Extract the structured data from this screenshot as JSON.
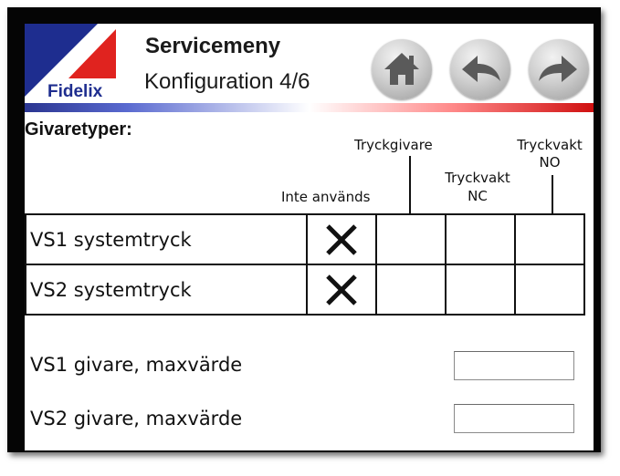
{
  "header": {
    "brand": "Fidelix",
    "title": "Servicemeny",
    "subtitle": "Konfiguration 4/6"
  },
  "nav": {
    "home_icon": "home-icon",
    "back_icon": "back-arrow-icon",
    "forward_icon": "forward-arrow-icon"
  },
  "section": {
    "title": "Givaretyper:"
  },
  "columns": {
    "unused": "Inte används",
    "sensor": "Tryckgivare",
    "switch_nc_line1": "Tryckvakt",
    "switch_nc_line2": "NC",
    "switch_no_line1": "Tryckvakt",
    "switch_no_line2": "NO"
  },
  "rows": [
    {
      "label": "VS1 systemtryck",
      "selected": "unused"
    },
    {
      "label": "VS2 systemtryck",
      "selected": "unused"
    }
  ],
  "maxvalues": [
    {
      "label": "VS1 givare, maxvärde",
      "value": ""
    },
    {
      "label": "VS2 givare, maxvärde",
      "value": ""
    }
  ],
  "colors": {
    "logo_blue": "#1e2d8f",
    "logo_red": "#e0231f",
    "stripe_left": "#2a3590",
    "stripe_right": "#d01010"
  }
}
